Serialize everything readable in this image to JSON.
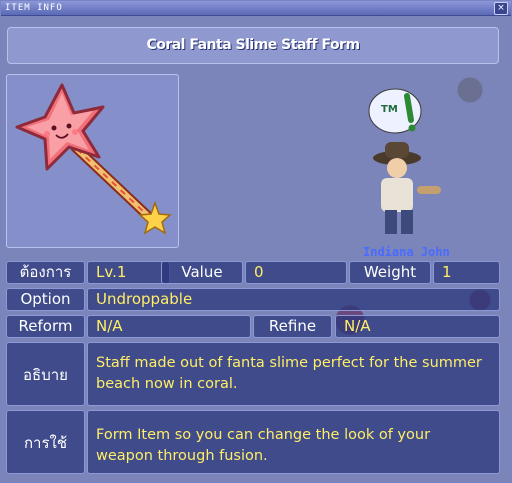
{
  "window": {
    "title": "ITEM INFO",
    "close_glyph": "×"
  },
  "item": {
    "name": "Coral Fanta Slime Staff Form",
    "image": "star-staff-icon"
  },
  "world": {
    "npc_badge": "TM",
    "character_name": "Indiana John"
  },
  "stats": {
    "req_label": "ต้องการ",
    "level_value": "Lv.1",
    "value_label": "Value",
    "value_value": "0",
    "weight_label": "Weight",
    "weight_value": "1",
    "option_label": "Option",
    "option_value": "Undroppable",
    "reform_label": "Reform",
    "reform_value": "N/A",
    "refine_label": "Refine",
    "refine_value": "N/A",
    "desc_label": "อธิบาย",
    "desc_value": "Staff made out of fanta slime perfect for the summer beach now in coral.",
    "usage_label": "การใช้",
    "usage_value": "Form Item so you can change the look of your weapon through fusion."
  },
  "colors": {
    "value_text": "#ffee66",
    "label_text": "#ffffff",
    "panel": "#28347a"
  }
}
